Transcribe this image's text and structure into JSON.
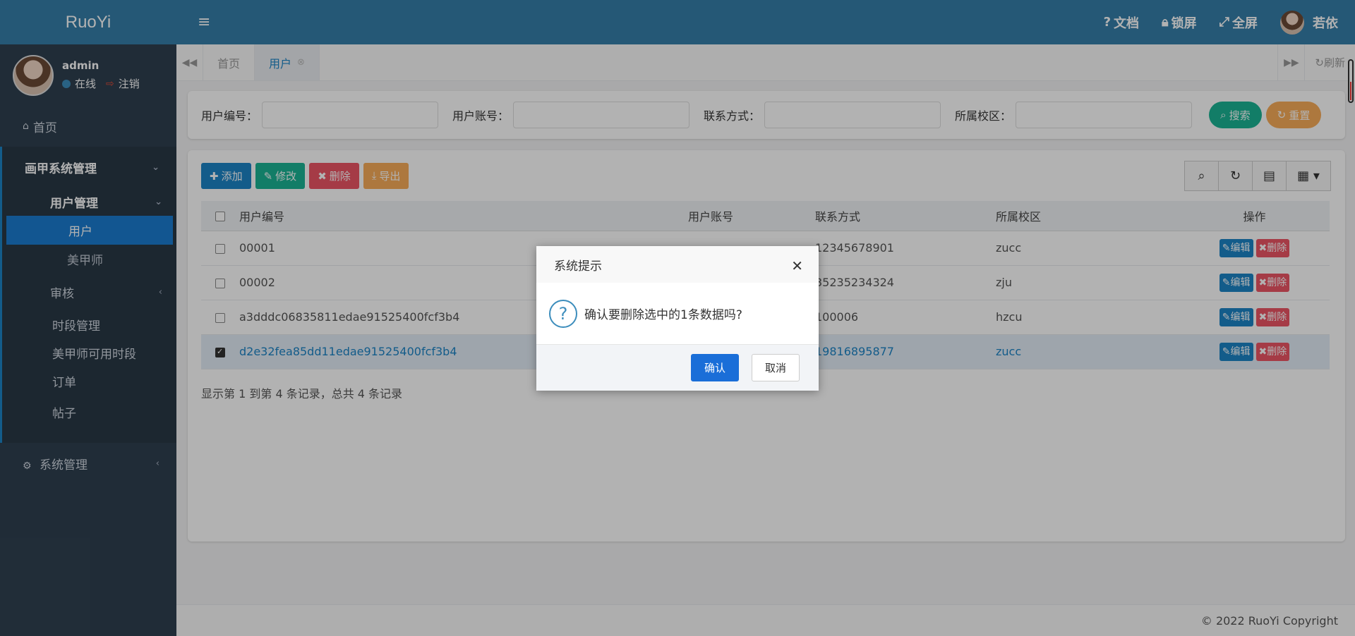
{
  "app": {
    "logo": "RuoYi"
  },
  "user": {
    "name": "admin",
    "status": "在线",
    "logout": "注销",
    "display_name": "若依"
  },
  "topbar": {
    "docs": "文档",
    "lock": "锁屏",
    "fullscreen": "全屏"
  },
  "sidebar": {
    "home": "首页",
    "group": "画甲系统管理",
    "user_mgmt": "用户管理",
    "user": "用户",
    "manicurist": "美甲师",
    "review": "审核",
    "timeslot": "时段管理",
    "manicurist_slots": "美甲师可用时段",
    "orders": "订单",
    "posts": "帖子",
    "system": "系统管理"
  },
  "tabs": {
    "home": "首页",
    "users": "用户",
    "refresh": "刷新"
  },
  "search": {
    "user_id_label": "用户编号：",
    "account_label": "用户账号：",
    "contact_label": "联系方式：",
    "campus_label": "所属校区：",
    "search_btn": "搜索",
    "reset_btn": "重置"
  },
  "toolbar": {
    "add": "添加",
    "edit": "修改",
    "delete": "删除",
    "export": "导出"
  },
  "table": {
    "headers": [
      "用户编号",
      "用户账号",
      "联系方式",
      "所属校区",
      "操作"
    ],
    "rows": [
      {
        "id": "00001",
        "account": "",
        "contact": "12345678901",
        "campus": "zucc",
        "checked": false
      },
      {
        "id": "00002",
        "account": "",
        "contact": "35235234324",
        "campus": "zju",
        "checked": false
      },
      {
        "id": "a3dddc06835811edae91525400fcf3b4",
        "account": "",
        "contact": "100006",
        "campus": "hzcu",
        "checked": false
      },
      {
        "id": "d2e32fea85dd11edae91525400fcf3b4",
        "account": "",
        "contact": "19816895877",
        "campus": "zucc",
        "checked": true
      }
    ],
    "edit_label": "编辑",
    "delete_label": "删除",
    "pager": "显示第 1 到第 4 条记录，总共 4 条记录"
  },
  "footer": "© 2022 RuoYi Copyright",
  "dialog": {
    "title": "系统提示",
    "message": "确认要删除选中的1条数据吗?",
    "confirm": "确认",
    "cancel": "取消"
  }
}
